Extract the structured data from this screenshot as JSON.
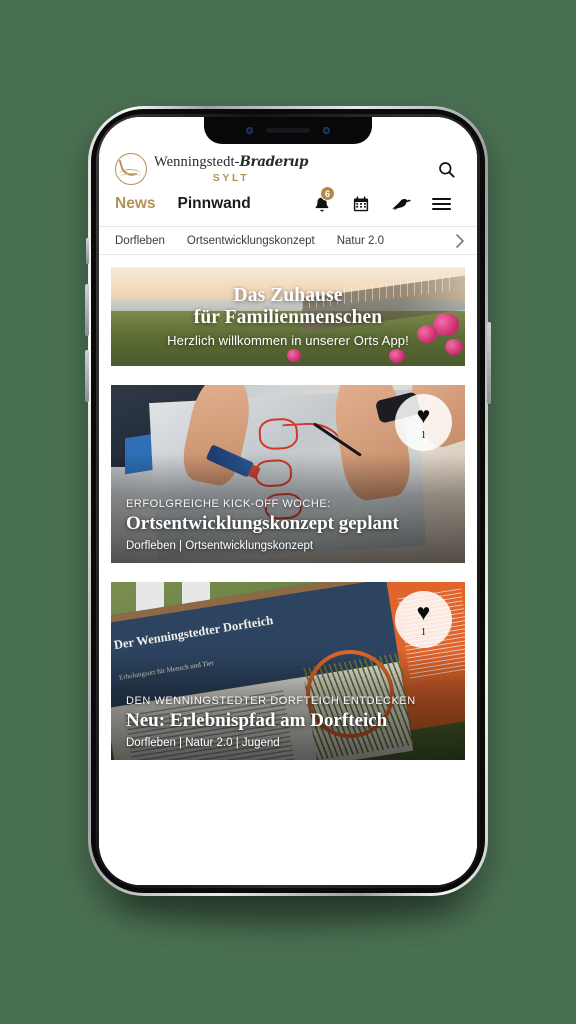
{
  "device": {
    "type": "smartphone",
    "notch": true
  },
  "app": {
    "brand": {
      "name_main": "Wenningstedt-",
      "name_script": "Braderup",
      "subtitle": "SYLT"
    },
    "search": {
      "icon": "search-icon",
      "label": "Suche"
    },
    "nav": {
      "tabs": [
        {
          "label": "News",
          "active": false
        },
        {
          "label": "Pinnwand",
          "active": true
        }
      ],
      "icons": [
        {
          "name": "bell-icon",
          "glyph": "🔔",
          "badge": "6"
        },
        {
          "name": "calendar-icon",
          "glyph": "📅"
        },
        {
          "name": "bird-icon",
          "glyph": "🐦"
        },
        {
          "name": "menu-icon",
          "glyph": "☰"
        }
      ],
      "badge_color": "#b08a4a",
      "active_color": "#1b1b1b",
      "inactive_color": "#b29258"
    },
    "categories": {
      "chips": [
        "Dorfleben",
        "Ortsentwicklungskonzept",
        "Natur 2.0"
      ],
      "scroll_arrow": "›"
    },
    "hero": {
      "title_line1": "Das Zuhause",
      "title_line2": "für Familienmenschen",
      "subtitle": "Herzlich willkommen in unserer Orts App!"
    },
    "articles": [
      {
        "kicker": "ERFOLGREICHE KICK-OFF WOCHE:",
        "headline": "Ortsentwicklungskonzept geplant",
        "categories": "Dorfleben | Ortsentwicklungskonzept",
        "fav_icon": "♥",
        "fav_count": "1"
      },
      {
        "kicker": "DEN WENNINGSTEDTER DORFTEICH ENTDECKEN",
        "headline": "Neu: Erlebnispfad am Dorfteich",
        "categories": "Dorfleben | Natur 2.0 | Jugend",
        "fav_icon": "♥",
        "fav_count": "1"
      }
    ],
    "board": {
      "title": "Der Wenningstedter Dorfteich",
      "subtitle": "Erholungsort für Mensch und Tier"
    },
    "colors": {
      "page_background": "#4a7052",
      "brand_gold": "#b29258",
      "accent_orange": "#e0652c"
    }
  }
}
